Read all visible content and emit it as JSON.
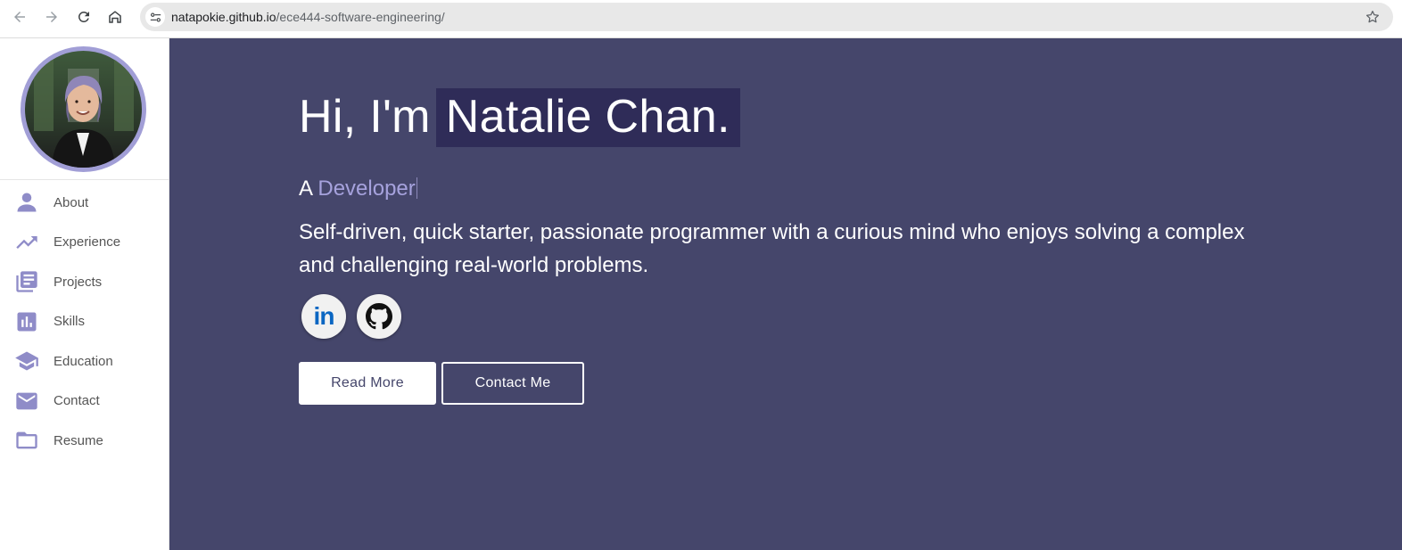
{
  "browser": {
    "url_host": "natapokie.github.io",
    "url_path": "/ece444-software-engineering/",
    "icons": [
      "back-icon",
      "forward-icon",
      "reload-icon",
      "home-icon",
      "site-info-icon",
      "bookmark-star-icon"
    ]
  },
  "sidebar": {
    "avatar_alt": "profile-photo",
    "items": [
      {
        "label": "About",
        "icon": "person-icon"
      },
      {
        "label": "Experience",
        "icon": "trending-up-icon"
      },
      {
        "label": "Projects",
        "icon": "library-books-icon"
      },
      {
        "label": "Skills",
        "icon": "bar-chart-icon"
      },
      {
        "label": "Education",
        "icon": "school-icon"
      },
      {
        "label": "Contact",
        "icon": "mail-icon"
      },
      {
        "label": "Resume",
        "icon": "folder-icon"
      }
    ]
  },
  "hero": {
    "greeting_prefix": "Hi, I'm",
    "name": "Natalie Chan.",
    "role_prefix": "A",
    "role_word": "Developer",
    "tagline": "Self-driven, quick starter, passionate programmer with a curious mind who enjoys solving a complex and challenging real-world problems.",
    "social": [
      {
        "name": "LinkedIn",
        "icon": "linkedin-icon",
        "glyph": "in"
      },
      {
        "name": "GitHub",
        "icon": "github-icon"
      }
    ],
    "read_more_label": "Read More",
    "contact_label": "Contact Me"
  },
  "colors": {
    "hero_bg": "#45466b",
    "name_highlight": "#2f2c58",
    "accent": "#a6a2dd",
    "sidebar_icon": "#8f8cc8",
    "avatar_ring": "#a19ed6"
  }
}
